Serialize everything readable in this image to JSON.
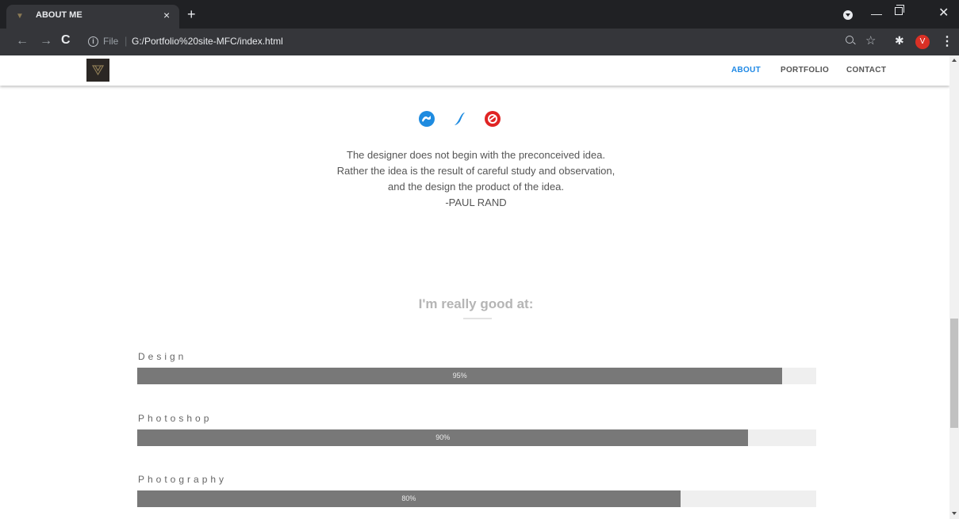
{
  "browser": {
    "tab_title": "ABOUT ME",
    "tab_close": "×",
    "new_tab": "+",
    "file_label": "File",
    "url": "G:/Portfolio%20site-MFC/index.html",
    "avatar_letter": "V"
  },
  "nav": {
    "links": [
      "ABOUT",
      "PORTFOLIO",
      "CONTACT"
    ],
    "active_color": "#1e88e5"
  },
  "social_icons": [
    "behance-icon",
    "vimeo-icon",
    "dribbble-icon"
  ],
  "quote": {
    "lines": [
      "The designer does not begin with the preconceived idea.",
      "Rather the idea is the result of careful study and observation,",
      "and the design the product of the idea.",
      "-PAUL RAND"
    ]
  },
  "skills": {
    "heading": "I'm really good at:",
    "items": [
      {
        "label": "Design",
        "percent_text": "95%",
        "value": 95
      },
      {
        "label": "Photoshop",
        "percent_text": "90%",
        "value": 90
      },
      {
        "label": "Photography",
        "percent_text": "80%",
        "value": 80
      }
    ]
  },
  "colors": {
    "bar_fill": "#787878",
    "bar_track": "#efefef",
    "heading": "#b5b5b5"
  }
}
